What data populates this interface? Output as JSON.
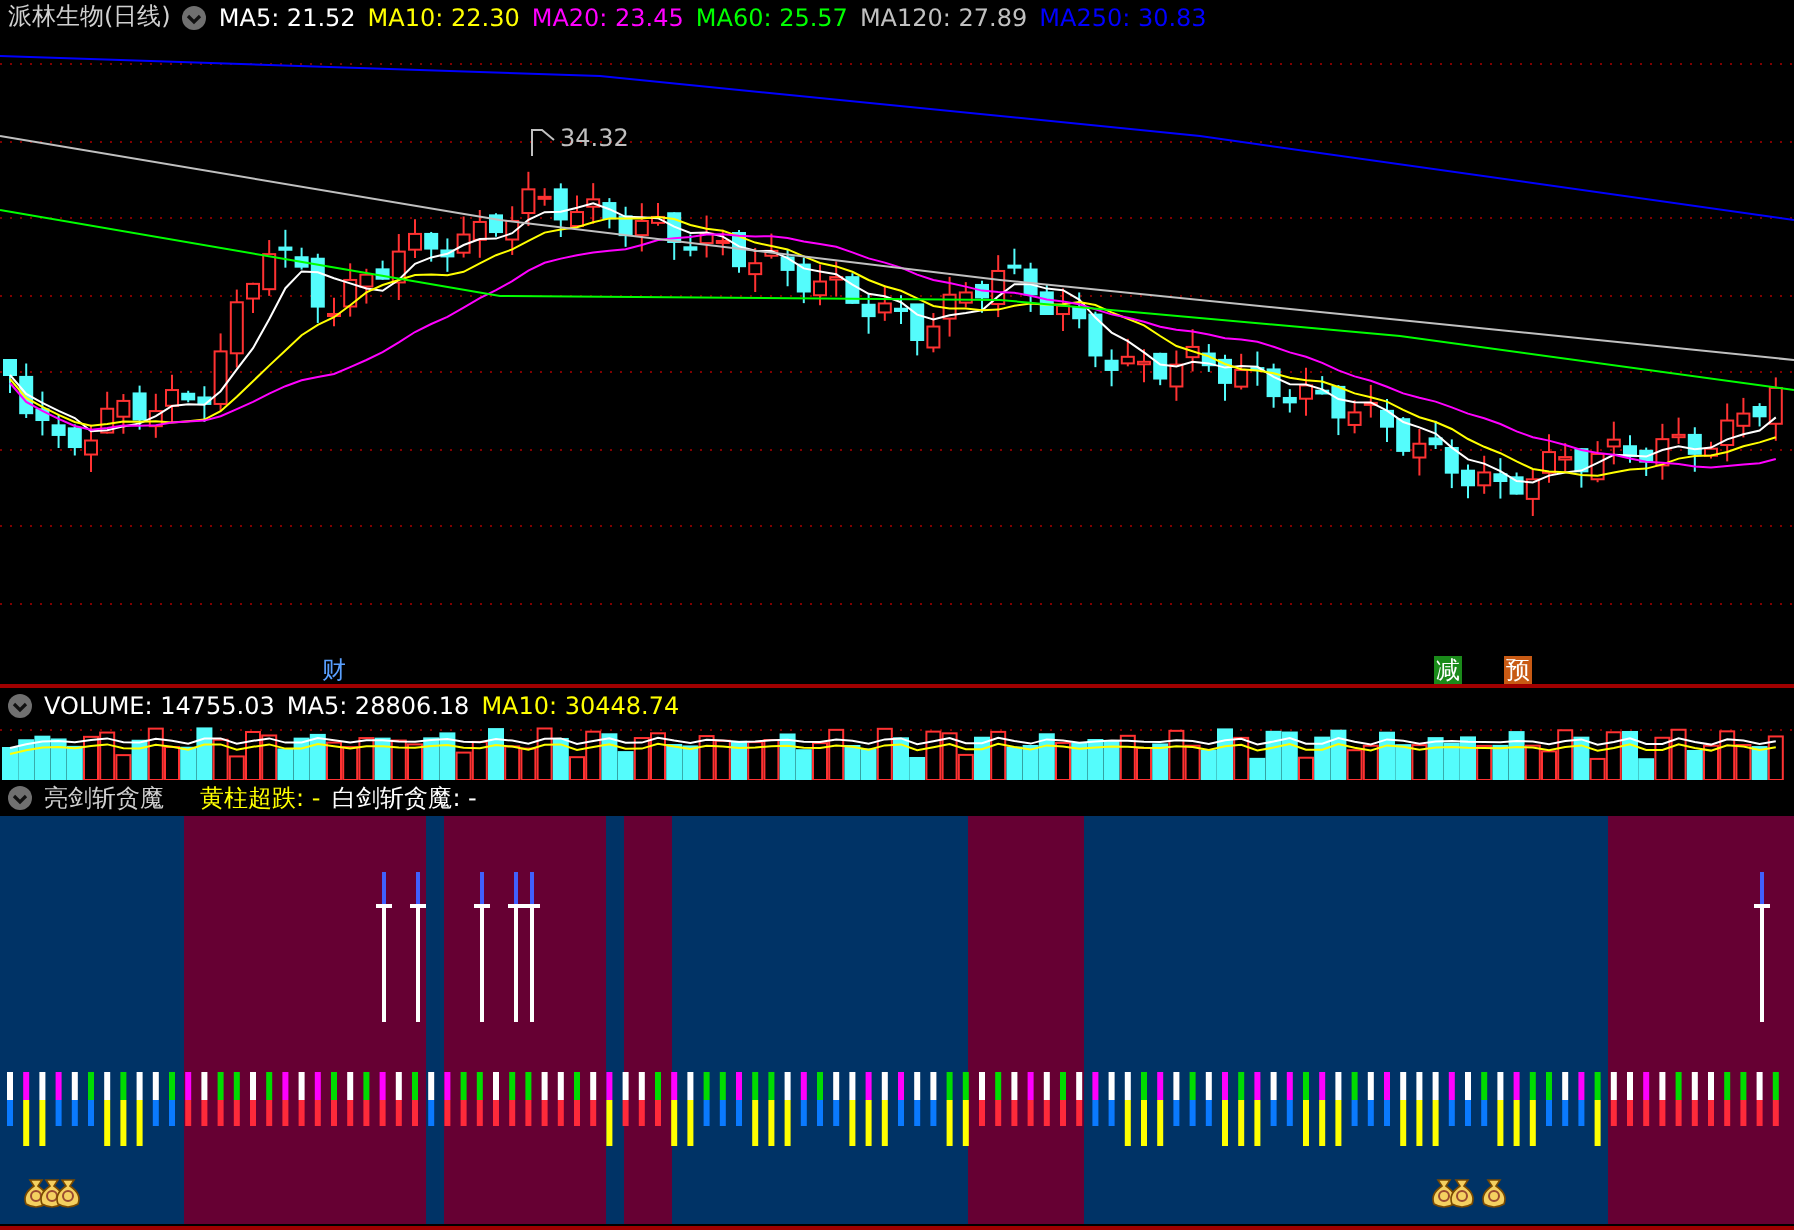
{
  "title": "派林生物(日线)",
  "ma_legend": [
    {
      "label": "MA5: 21.52",
      "color": "#ffffff"
    },
    {
      "label": "MA10: 22.30",
      "color": "#ffff00"
    },
    {
      "label": "MA20: 23.45",
      "color": "#ff00ff"
    },
    {
      "label": "MA60: 25.57",
      "color": "#00ff00"
    },
    {
      "label": "MA120: 27.89",
      "color": "#c0c0c0"
    },
    {
      "label": "MA250: 30.83",
      "color": "#0000ff"
    }
  ],
  "price_chart": {
    "high_label": "34.32",
    "markers": [
      {
        "text": "财",
        "kind": "text",
        "color": "#5aa0ff"
      },
      {
        "text": "减",
        "kind": "tag",
        "color": "#1a8a1a"
      },
      {
        "text": "预",
        "kind": "tag",
        "color": "#c85a14"
      }
    ]
  },
  "volume_legend": [
    {
      "label": "VOLUME: 14755.03",
      "color": "#ffffff"
    },
    {
      "label": "MA5: 28806.18",
      "color": "#ffffff"
    },
    {
      "label": "MA10: 30448.74",
      "color": "#ffff00"
    }
  ],
  "indicator": {
    "name": "亮剑斩贪魔",
    "legend": [
      {
        "label": "黄柱超跌: -",
        "kind": "column"
      },
      {
        "label": "白剑斩贪魔: -",
        "kind": "sword"
      }
    ]
  }
}
